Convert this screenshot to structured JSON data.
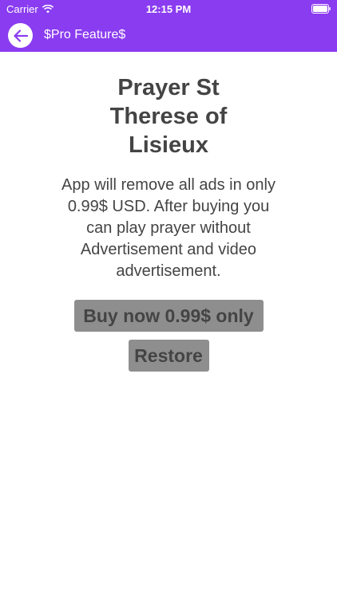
{
  "status_bar": {
    "carrier": "Carrier",
    "time": "12:15 PM"
  },
  "nav": {
    "title": "$Pro Feature$",
    "back_icon": "arrow-left-icon",
    "bar_color": "#8a3cf0"
  },
  "content": {
    "title": "Prayer St Therese of Lisieux",
    "description": "App will remove all ads in only 0.99$ USD. After buying you can play prayer without Advertisement and video advertisement.",
    "buy_label": "Buy now 0.99$ only",
    "restore_label": "Restore"
  }
}
